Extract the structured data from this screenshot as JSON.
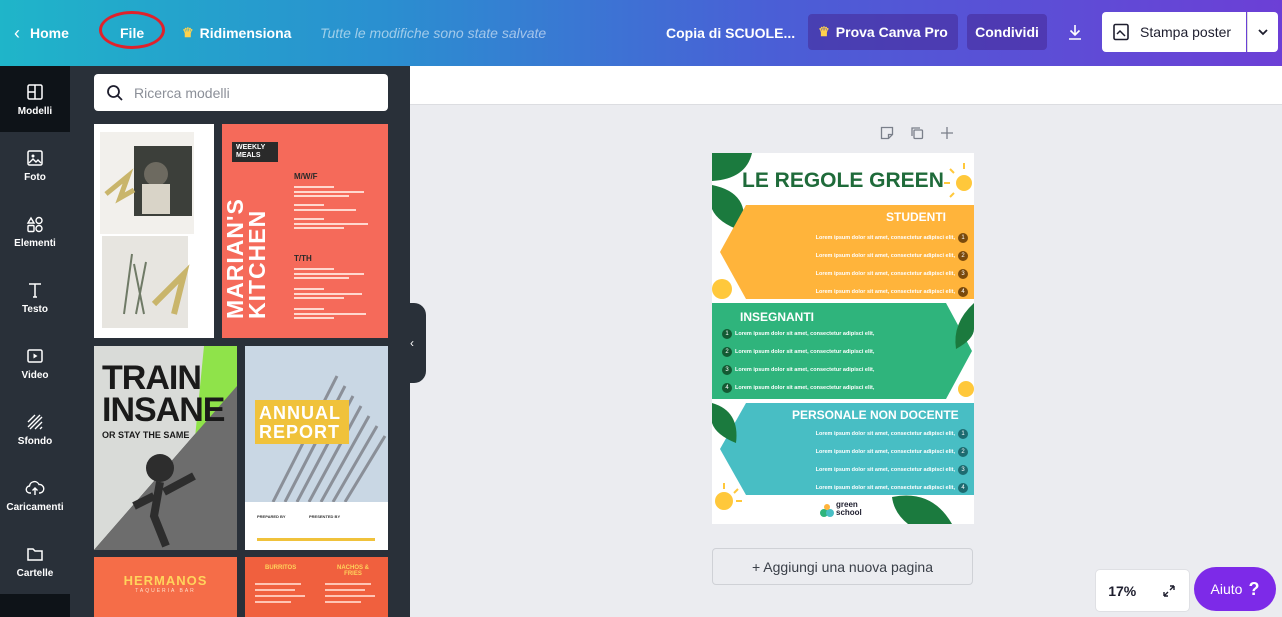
{
  "topbar": {
    "home_label": "Home",
    "file_label": "File",
    "resize_label": "Ridimensiona",
    "save_status": "Tutte le modifiche sono state salvate",
    "doc_title": "Copia di SCUOLE...",
    "pro_label": "Prova Canva Pro",
    "share_label": "Condividi",
    "print_label": "Stampa poster"
  },
  "rail": [
    {
      "label": "Modelli",
      "icon": "templates-icon"
    },
    {
      "label": "Foto",
      "icon": "photo-icon"
    },
    {
      "label": "Elementi",
      "icon": "elements-icon"
    },
    {
      "label": "Testo",
      "icon": "text-icon"
    },
    {
      "label": "Video",
      "icon": "video-icon"
    },
    {
      "label": "Sfondo",
      "icon": "background-icon"
    },
    {
      "label": "Caricamenti",
      "icon": "upload-icon"
    },
    {
      "label": "Cartelle",
      "icon": "folder-icon"
    }
  ],
  "search": {
    "placeholder": "Ricerca modelli"
  },
  "templates": {
    "t2_header": "WEEKLY MEALS",
    "t2_brand": "MARIAN'S KITCHEN",
    "t2_day1": "M/W/F",
    "t2_day2": "T/TH",
    "t3_title1": "TRAIN",
    "t3_title2": "INSANE",
    "t3_sub": "OR STAY THE SAME",
    "t4_title1": "ANNUAL",
    "t4_title2": "REPORT",
    "t4_prepared": "PREPARED BY",
    "t4_presented": "PRESENTED BY",
    "t5_title": "HERMANOS",
    "t5_sub": "TAQUERIA BAR",
    "t6_col1": "BURRITOS",
    "t6_col2": "NACHOS & FRIES"
  },
  "poster": {
    "title": "LE REGOLE GREEN",
    "section1": "STUDENTI",
    "section2": "INSEGNANTI",
    "section3": "PERSONALE NON DOCENTE",
    "line": "Lorem ipsum dolor sit amet, consectetur adipisci elit,",
    "numbers": [
      "1",
      "2",
      "3",
      "4"
    ],
    "logo_line1": "green",
    "logo_line2": "school",
    "colors": {
      "orange": "#ffb43b",
      "green": "#2fb47c",
      "teal": "#48bec4",
      "title": "#1f6b3a"
    }
  },
  "canvas": {
    "add_page_label": "+ Aggiungi una nuova pagina",
    "zoom": "17%",
    "help_label": "Aiuto",
    "help_mark": "?"
  }
}
